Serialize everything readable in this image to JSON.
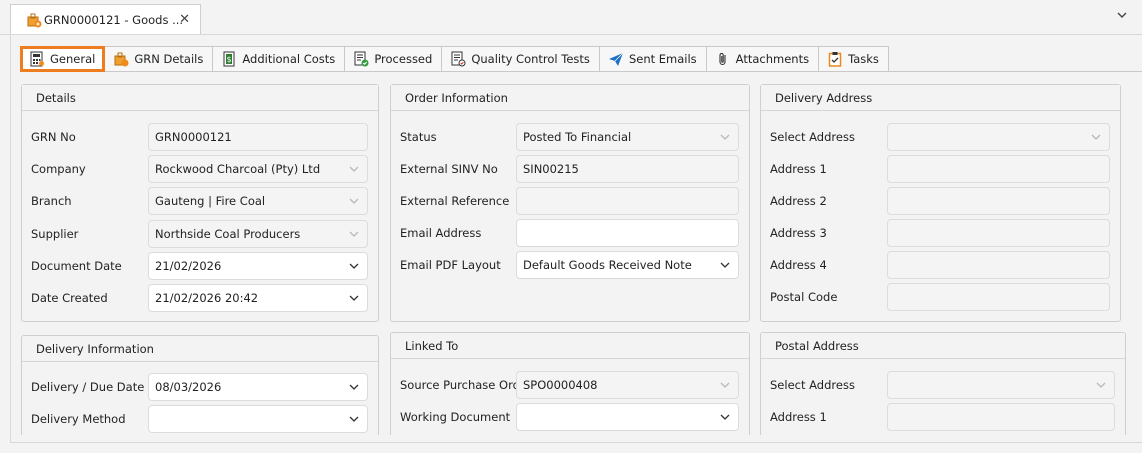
{
  "window": {
    "doc_tab_title": "GRN0000121 - Goods ...",
    "close_glyph": "✕"
  },
  "tabs": [
    {
      "label": "General",
      "icon": "calculator-icon",
      "active": true
    },
    {
      "label": "GRN Details",
      "icon": "grn-package-icon"
    },
    {
      "label": "Additional Costs",
      "icon": "dollar-document-icon"
    },
    {
      "label": "Processed",
      "icon": "processed-list-icon"
    },
    {
      "label": "Quality Control Tests",
      "icon": "checklist-icon"
    },
    {
      "label": "Sent Emails",
      "icon": "paper-plane-icon"
    },
    {
      "label": "Attachments",
      "icon": "paperclip-icon"
    },
    {
      "label": "Tasks",
      "icon": "clipboard-check-icon"
    }
  ],
  "details": {
    "title": "Details",
    "grn_no_label": "GRN No",
    "grn_no": "GRN0000121",
    "company_label": "Company",
    "company": "Rockwood Charcoal (Pty) Ltd",
    "branch_label": "Branch",
    "branch": "Gauteng | Fire Coal",
    "supplier_label": "Supplier",
    "supplier": "Northside Coal Producers",
    "document_date_label": "Document Date",
    "document_date": "21/02/2026",
    "date_created_label": "Date Created",
    "date_created": "21/02/2026 20:42"
  },
  "order_info": {
    "title": "Order Information",
    "status_label": "Status",
    "status": "Posted To Financial",
    "sinv_label": "External SINV No",
    "sinv": "SIN00215",
    "ext_ref_label": "External Reference",
    "ext_ref": "",
    "email_label": "Email Address",
    "email": "",
    "pdf_layout_label": "Email PDF Layout",
    "pdf_layout": "Default Goods Received Note"
  },
  "delivery_address": {
    "title": "Delivery Address",
    "select_label": "Select Address",
    "select": "",
    "addr1_label": "Address 1",
    "addr1": "",
    "addr2_label": "Address 2",
    "addr2": "",
    "addr3_label": "Address 3",
    "addr3": "",
    "addr4_label": "Address 4",
    "addr4": "",
    "postal_code_label": "Postal Code",
    "postal_code": ""
  },
  "delivery_info": {
    "title": "Delivery Information",
    "due_date_label": "Delivery / Due Date",
    "due_date": "08/03/2026",
    "method_label": "Delivery Method",
    "method": ""
  },
  "linked_to": {
    "title": "Linked To",
    "source_po_label": "Source Purchase Order",
    "source_po": "SPO0000408",
    "working_doc_label": "Working Document",
    "working_doc": ""
  },
  "postal_address": {
    "title": "Postal Address",
    "select_label": "Select Address",
    "select": "",
    "addr1_label": "Address 1",
    "addr1": ""
  },
  "colors": {
    "accent": "#ee7d1f",
    "panel_border": "#cfcfcf"
  }
}
